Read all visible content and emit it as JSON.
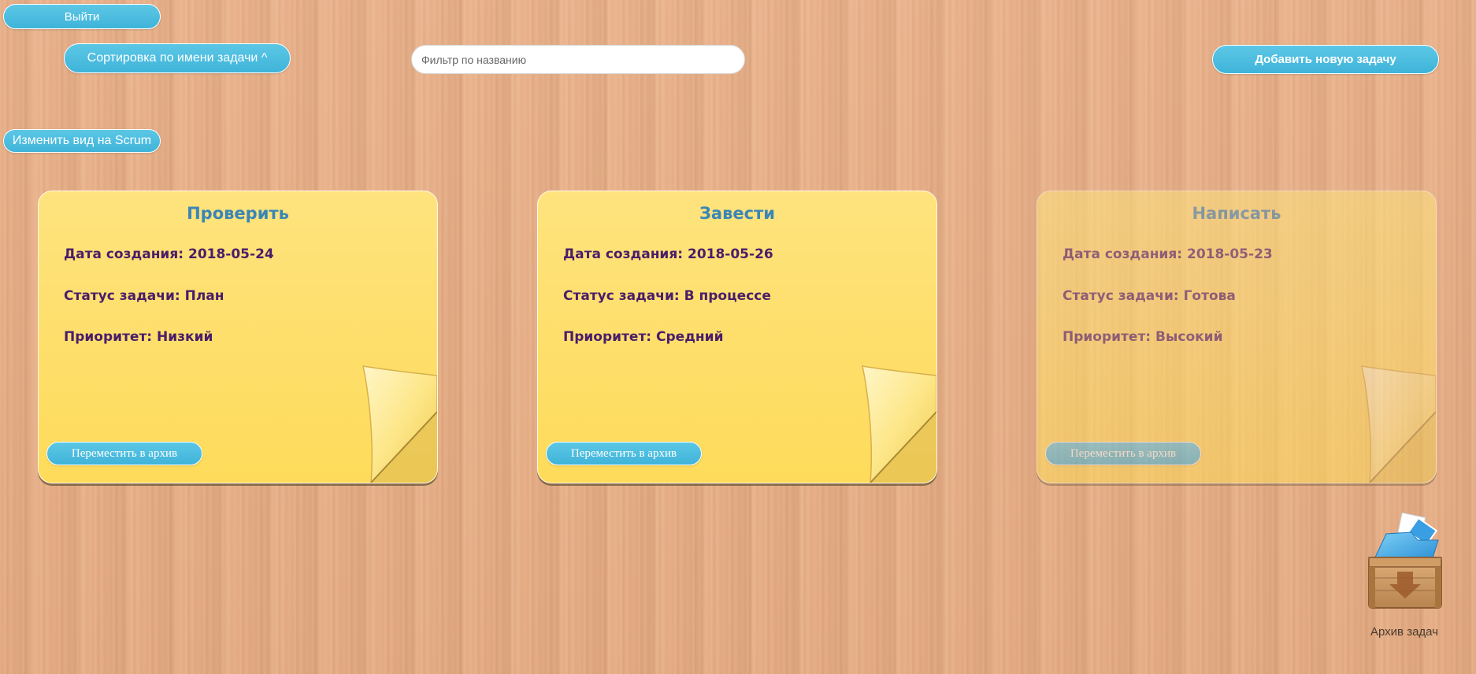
{
  "header": {
    "logout_label": "Выйти",
    "sort_label": "Сортировка по имени задачи ^",
    "filter": {
      "value": "",
      "placeholder": "Фильтр по названию"
    },
    "add_label": "Добавить новую задачу",
    "view_label": "Изменить вид на Scrum"
  },
  "tasks": [
    {
      "title": "Проверить",
      "date_label": "Дата создания:",
      "date": "2018-05-24",
      "status_label": "Статус задачи:",
      "status": "План",
      "priority_label": "Приоритет:",
      "priority": "Низкий",
      "archive_label": "Переместить в архив"
    },
    {
      "title": "Завести",
      "date_label": "Дата создания:",
      "date": "2018-05-26",
      "status_label": "Статус задачи:",
      "status": "В процессе",
      "priority_label": "Приоритет:",
      "priority": "Средний",
      "archive_label": "Переместить в архив"
    },
    {
      "title": "Написать",
      "date_label": "Дата создания:",
      "date": "2018-05-23",
      "status_label": "Статус задачи:",
      "status": "Готова",
      "priority_label": "Приоритет:",
      "priority": "Высокий",
      "archive_label": "Переместить в архив"
    }
  ],
  "archive": {
    "label": "Архив задач",
    "icon": "archive-box-icon"
  },
  "colors": {
    "button": "#3fb4d9",
    "note": "#fedb5a",
    "note_title": "#3a86b6",
    "note_text": "#4a1d6a",
    "wood": "#e7b089"
  }
}
